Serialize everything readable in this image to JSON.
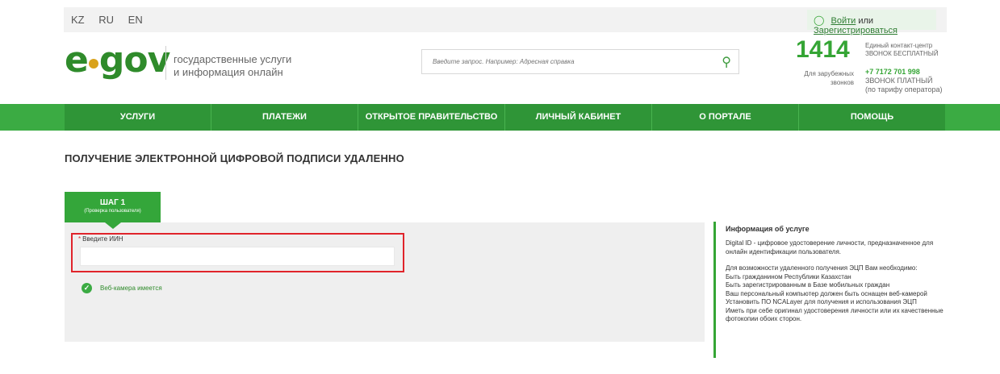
{
  "header": {
    "languages": [
      "KZ",
      "RU",
      "EN"
    ],
    "auth": {
      "login": "Войти",
      "or": "или",
      "register": "Зарегистрироваться"
    },
    "logo": {
      "e": "e",
      "gov": "gov"
    },
    "slogan": [
      "государственные услуги",
      "и информация онлайн"
    ],
    "search": {
      "placeholder": "Введите запрос. Например: Адресная справка"
    },
    "contact": {
      "number": "1414",
      "desc_line1": "Единый контакт-центр",
      "desc_line2": "ЗВОНОК БЕСПЛАТНЫЙ",
      "abroad_line1": "Для зарубежных",
      "abroad_line2": "звонков",
      "abroad_phone": "+7 7172 701 998",
      "paid_line1": "ЗВОНОК ПЛАТНЫЙ",
      "paid_line2": "(по тарифу оператора)"
    }
  },
  "nav": {
    "items": [
      {
        "label": "УСЛУГИ"
      },
      {
        "label": "ПЛАТЕЖИ"
      },
      {
        "label": "ОТКРЫТОЕ ПРАВИТЕЛЬСТВО"
      },
      {
        "label": "ЛИЧНЫЙ КАБИНЕТ"
      },
      {
        "label": "О ПОРТАЛЕ"
      },
      {
        "label": "ПОМОЩЬ"
      }
    ]
  },
  "page": {
    "title": "ПОЛУЧЕНИЕ ЭЛЕКТРОННОЙ ЦИФРОВОЙ ПОДПИСИ УДАЛЕННО",
    "step": {
      "title": "ШАГ 1",
      "subtitle": "(Проверка пользователя)"
    },
    "form": {
      "required_mark": "*",
      "iin_label": "Введите ИИН",
      "iin_value": "",
      "webcam_status": "Веб-камера имеется"
    }
  },
  "info": {
    "title": "Информация об услуге",
    "intro": "Digital ID - цифровое удостоверение личности, предназначенное для онлайн идентификации пользователя.",
    "lines": [
      "Для возможности удаленного получения ЭЦП Вам необходимо:",
      "Быть гражданином Республики Казахстан",
      "Быть зарегистрированным в Базе мобильных граждан",
      "Ваш персональный компьютер должен быть оснащен веб-камерой",
      "Установить ПО NCALayer для получения и использования ЭЦП",
      "Иметь при себе оригинал удостоверения личности или их качественные фотокопии обоих сторон."
    ]
  },
  "colors": {
    "brand_green": "#35a535",
    "nav_green": "#2f9537",
    "highlight_red": "#e0242b",
    "logo_gold": "#d9a21b"
  },
  "icons": {
    "user": "user-icon",
    "search": "search-icon",
    "webcam_check": "check-circle-icon"
  }
}
